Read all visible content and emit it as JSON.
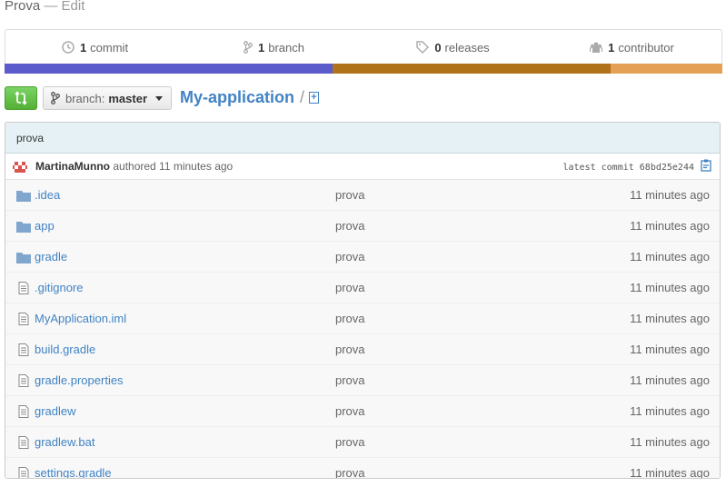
{
  "header": {
    "repo_label": "Prova",
    "edit_label": "Edit"
  },
  "stats": {
    "commits": {
      "count": "1",
      "label": "commit"
    },
    "branches": {
      "count": "1",
      "label": "branch"
    },
    "releases": {
      "count": "0",
      "label": "releases"
    },
    "contributors": {
      "count": "1",
      "label": "contributor"
    }
  },
  "language_bar": [
    {
      "color": "#5c5bcc",
      "fraction": 0.457
    },
    {
      "color": "#b07219",
      "fraction": 0.387
    },
    {
      "color": "#e4a055",
      "fraction": 0.156
    }
  ],
  "toolbar": {
    "branch_label": "branch:",
    "branch_value": "master",
    "repo_name": "My-application",
    "separator": "/"
  },
  "commit": {
    "message": "prova",
    "author": "MartinaMunno",
    "authored_text": "authored 11 minutes ago",
    "latest_commit_text": "latest commit 68bd25e244"
  },
  "files": [
    {
      "type": "dir",
      "name": ".idea",
      "message": "prova",
      "age": "11 minutes ago"
    },
    {
      "type": "dir",
      "name": "app",
      "message": "prova",
      "age": "11 minutes ago"
    },
    {
      "type": "dir",
      "name": "gradle",
      "message": "prova",
      "age": "11 minutes ago"
    },
    {
      "type": "file",
      "name": ".gitignore",
      "message": "prova",
      "age": "11 minutes ago"
    },
    {
      "type": "file",
      "name": "MyApplication.iml",
      "message": "prova",
      "age": "11 minutes ago"
    },
    {
      "type": "file",
      "name": "build.gradle",
      "message": "prova",
      "age": "11 minutes ago"
    },
    {
      "type": "file",
      "name": "gradle.properties",
      "message": "prova",
      "age": "11 minutes ago"
    },
    {
      "type": "file",
      "name": "gradlew",
      "message": "prova",
      "age": "11 minutes ago"
    },
    {
      "type": "file",
      "name": "gradlew.bat",
      "message": "prova",
      "age": "11 minutes ago"
    },
    {
      "type": "file",
      "name": "settings.gradle",
      "message": "prova",
      "age": "11 minutes ago"
    }
  ],
  "icons": {
    "folder": "folder-icon",
    "file": "file-icon",
    "clone": "clone-icon",
    "branch": "branch-icon",
    "clipboard": "clipboard-icon"
  }
}
